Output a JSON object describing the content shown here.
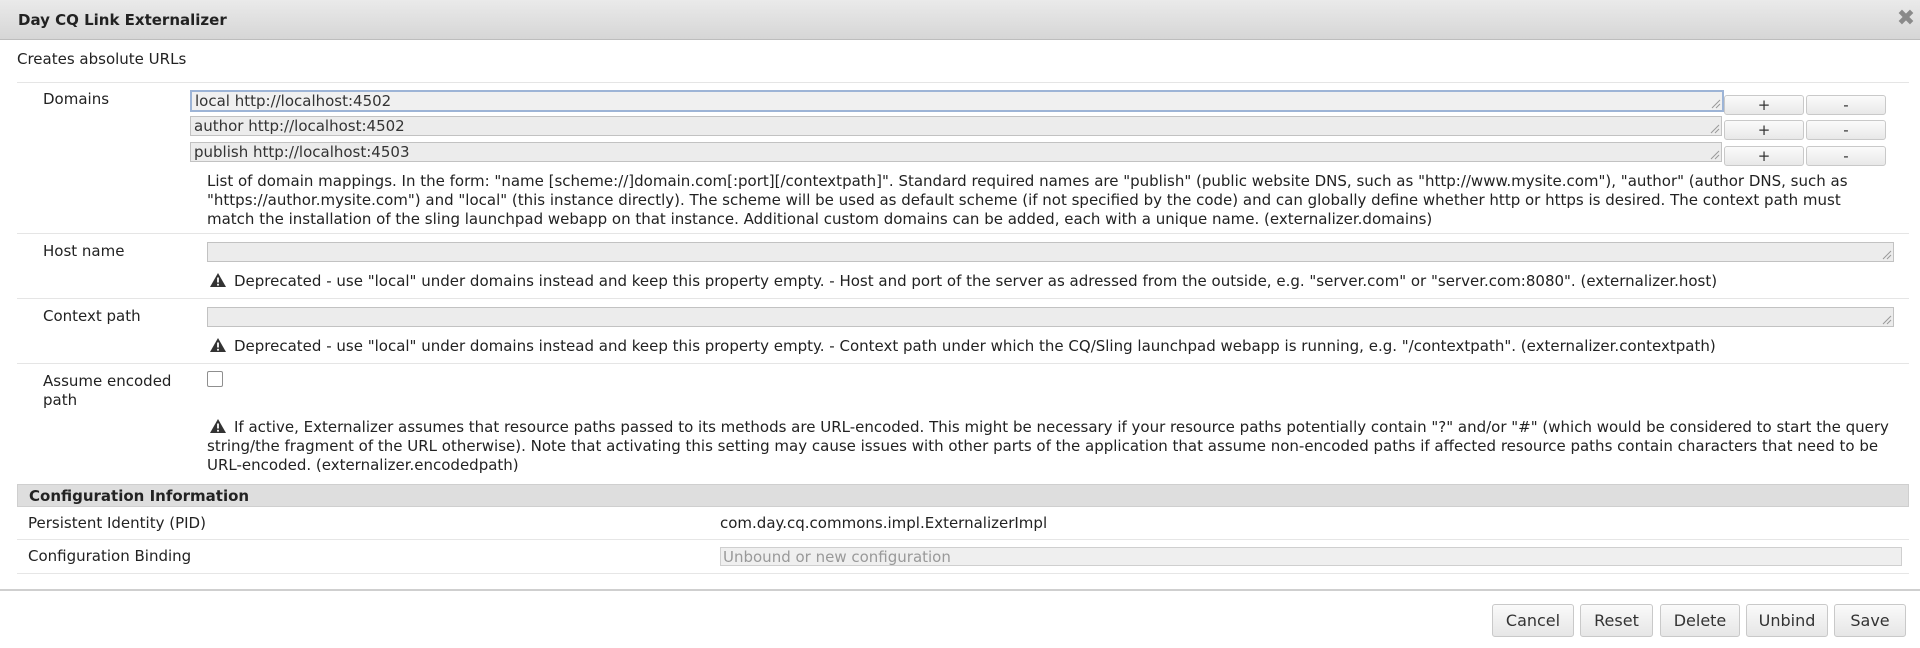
{
  "dialog": {
    "title": "Day CQ Link Externalizer",
    "subtitle": "Creates absolute URLs"
  },
  "domains": {
    "label": "Domains",
    "values": [
      "local http://localhost:4502",
      "author http://localhost:4502",
      "publish http://localhost:4503"
    ],
    "add_label": "+",
    "remove_label": "-",
    "description": "List of domain mappings. In the form: \"name [scheme://]domain.com[:port][/contextpath]\". Standard required names are \"publish\" (public website DNS, such as \"http://www.mysite.com\"), \"author\" (author DNS, such as \"https://author.mysite.com\") and \"local\" (this instance directly). The scheme will be used as default scheme (if not specified by the code) and can globally define whether http or https is desired. The context path must match the installation of the sling launchpad webapp on that instance. Additional custom domains can be added, each with a unique name. (externalizer.domains)"
  },
  "host_name": {
    "label": "Host name",
    "value": "",
    "description": "Deprecated - use \"local\" under domains instead and keep this property empty. - Host and port of the server as adressed from the outside, e.g. \"server.com\" or \"server.com:8080\". (externalizer.host)"
  },
  "context_path": {
    "label": "Context path",
    "value": "",
    "description": "Deprecated - use \"local\" under domains instead and keep this property empty. - Context path under which the CQ/Sling launchpad webapp is running, e.g. \"/contextpath\". (externalizer.contextpath)"
  },
  "encoded_path": {
    "label": "Assume encoded path",
    "checked": false,
    "description": "If active, Externalizer assumes that resource paths passed to its methods are URL-encoded. This might be necessary if your resource paths potentially contain \"?\" and/or \"#\" (which would be considered to start the query string/the fragment of the URL otherwise). Note that activating this setting may cause issues with other parts of the application that assume non-encoded paths if affected resource paths contain characters that need to be URL-encoded. (externalizer.encodedpath)"
  },
  "config_info": {
    "heading": "Configuration Information",
    "pid_label": "Persistent Identity (PID)",
    "pid_value": "com.day.cq.commons.impl.ExternalizerImpl",
    "binding_label": "Configuration Binding",
    "binding_placeholder": "Unbound or new configuration"
  },
  "footer": {
    "cancel": "Cancel",
    "reset": "Reset",
    "delete": "Delete",
    "unbind": "Unbind",
    "save": "Save"
  },
  "icons": {
    "close": "close-icon",
    "warning": "warning-icon",
    "resize": "resize-handle-icon"
  }
}
